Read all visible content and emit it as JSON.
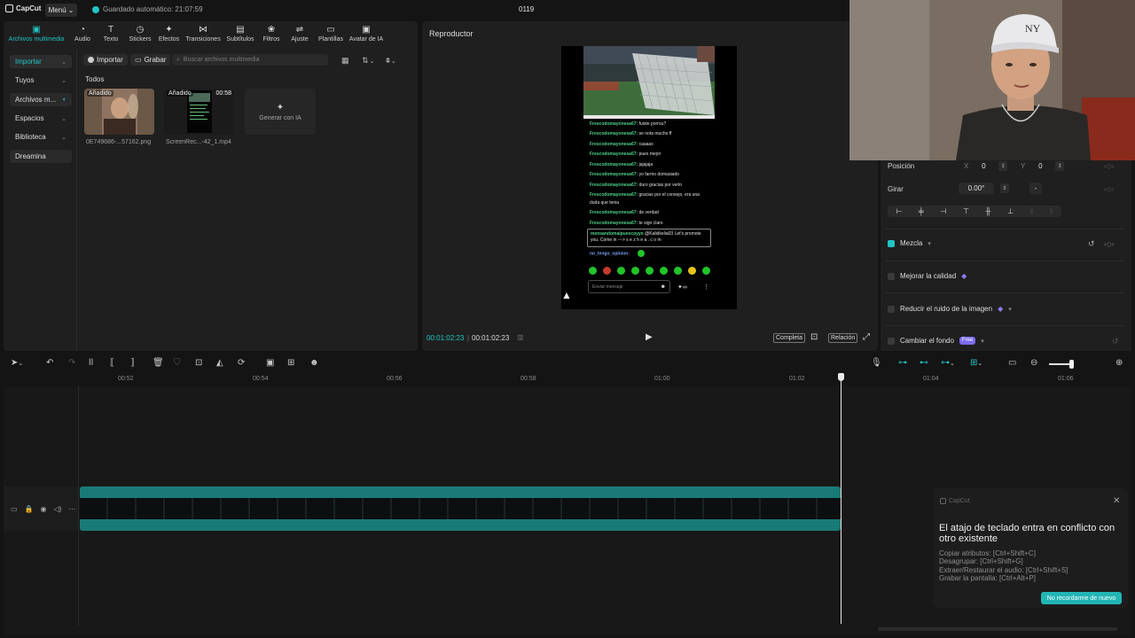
{
  "topbar": {
    "logo": "CapCut",
    "menu_label": "Menú",
    "autosave_text": "Guardado automático: 21:07:59",
    "project_title": "0119"
  },
  "tabs": [
    {
      "label": "Archivos multimedia",
      "icon": "play-box-icon"
    },
    {
      "label": "Audio",
      "icon": "audio-icon"
    },
    {
      "label": "Texto",
      "icon": "text-icon"
    },
    {
      "label": "Stickers",
      "icon": "sticker-icon"
    },
    {
      "label": "Efectos",
      "icon": "effects-icon"
    },
    {
      "label": "Transiciones",
      "icon": "transitions-icon"
    },
    {
      "label": "Subtítulos",
      "icon": "subtitles-icon"
    },
    {
      "label": "Filtros",
      "icon": "filters-icon"
    },
    {
      "label": "Ajuste",
      "icon": "adjust-icon"
    },
    {
      "label": "Plantillas",
      "icon": "templates-icon"
    },
    {
      "label": "Avatar de IA",
      "icon": "avatar-icon"
    }
  ],
  "sidebar": {
    "items": [
      {
        "label": "Importar"
      },
      {
        "label": "Tuyos"
      },
      {
        "label": "Archivos m..."
      },
      {
        "label": "Espacios"
      },
      {
        "label": "Biblioteca"
      },
      {
        "label": "Dreamina"
      }
    ]
  },
  "media": {
    "import_label": "Importar",
    "record_label": "Grabar",
    "search_placeholder": "Buscar archivos multimedia",
    "section_title": "Todos",
    "items": [
      {
        "badge": "Añadido",
        "duration": "",
        "name": "0E749686-...57162.png"
      },
      {
        "badge": "Añadido",
        "duration": "00:58",
        "name": "ScreenRec...-42_1.mp4"
      }
    ],
    "generate_ai_label": "Generar con IA"
  },
  "player": {
    "title": "Reproductor",
    "current_time": "00:01:02:23",
    "total_time": "00:01:02:23",
    "full_label": "Completa",
    "ratio_label": "Relación",
    "chat": [
      {
        "user": "Frescodomayonesa67:",
        "text": "fuiste porrou?"
      },
      {
        "user": "Frescodomayonesa67:",
        "text": "se nota mucho ff"
      },
      {
        "user": "Frescodomayonesa67:",
        "text": "caaaas"
      },
      {
        "user": "Frescodomayonesa67:",
        "text": "pues mejor"
      },
      {
        "user": "Frescodomayonesa67:",
        "text": "jajajaja"
      },
      {
        "user": "Frescodomayonesa67:",
        "text": "yo farmo domasiado"
      },
      {
        "user": "Frescodomayonesa67:",
        "text": "duro gracias por verlo"
      },
      {
        "user": "Frescodomayonesa67:",
        "text": "gracias por el consejo, era una"
      },
      {
        "user": "",
        "text": "duda que tenia"
      },
      {
        "user": "Frescodomayonesa67:",
        "text": "de verdad"
      },
      {
        "user": "Frescodomayonesa67:",
        "text": "te sigo claro"
      }
    ],
    "highlight_user": "mensandomaipuescoyyo",
    "highlight_text1": "@Kalidkelia03 Let's promote",
    "highlight_text2": "you. Come in ---> s e z h e a . c o m",
    "last_user": "no_tengo_opinion:",
    "message_placeholder": "Enviar mensaje"
  },
  "properties": {
    "position_label": "Posición",
    "x_label": "X",
    "x_value": "0",
    "y_label": "Y",
    "y_value": "0",
    "rotate_label": "Girar",
    "rotate_value": "0.00°",
    "rotate_extra": "-",
    "blend_label": "Mezcla",
    "quality_label": "Mejorar la calidad",
    "denoise_label": "Reducir el ruido de la imagen",
    "bg_label": "Cambiar el fondo",
    "free_badge": "Free"
  },
  "timeline": {
    "ticks": [
      "00:52",
      "00:54",
      "00:56",
      "00:58",
      "01:00",
      "01:02",
      "01:04",
      "01:06"
    ]
  },
  "notification": {
    "app": "CapCut",
    "title": "El atajo de teclado entra en conflicto con otro existente",
    "lines": [
      "Copiar atributos: [Ctrl+Shift+C]",
      "Desagrupar: [Ctrl+Shift+G]",
      "Extraer/Restaurar el audio: [Ctrl+Shift+S]",
      "Grabar la pantalla: [Ctrl+Alt+P]"
    ],
    "button": "No recordarme de nuevo"
  },
  "colors": {
    "accent": "#22c4c4",
    "panel": "#1f1f1f",
    "background": "#141414"
  }
}
